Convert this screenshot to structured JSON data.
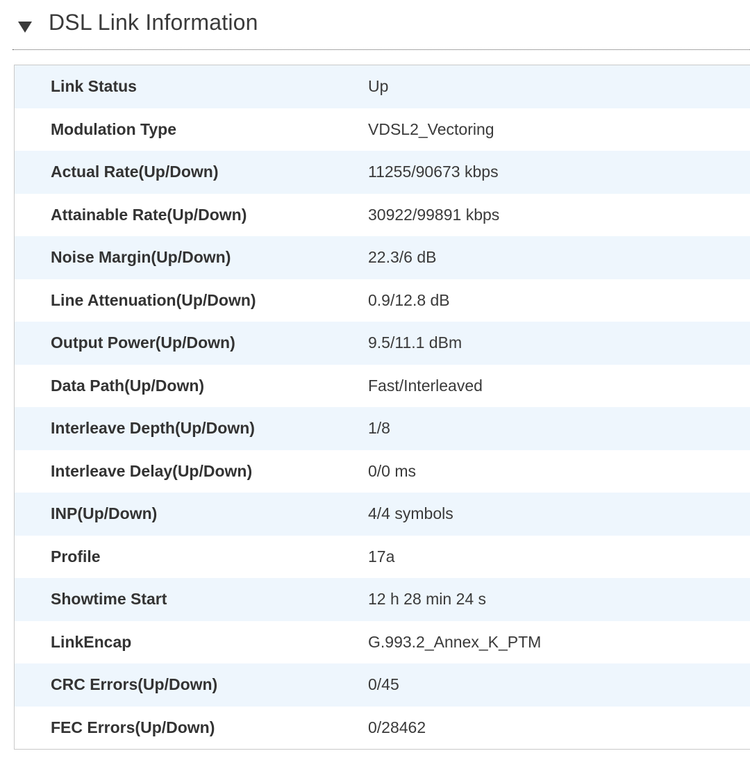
{
  "section": {
    "title": "DSL Link Information"
  },
  "rows": [
    {
      "label": "Link Status",
      "value": "Up"
    },
    {
      "label": "Modulation Type",
      "value": "VDSL2_Vectoring"
    },
    {
      "label": "Actual Rate(Up/Down)",
      "value": "11255/90673 kbps"
    },
    {
      "label": "Attainable Rate(Up/Down)",
      "value": "30922/99891 kbps"
    },
    {
      "label": "Noise Margin(Up/Down)",
      "value": "22.3/6 dB"
    },
    {
      "label": "Line Attenuation(Up/Down)",
      "value": "0.9/12.8 dB"
    },
    {
      "label": "Output Power(Up/Down)",
      "value": "9.5/11.1 dBm"
    },
    {
      "label": "Data Path(Up/Down)",
      "value": "Fast/Interleaved"
    },
    {
      "label": "Interleave Depth(Up/Down)",
      "value": "1/8"
    },
    {
      "label": "Interleave Delay(Up/Down)",
      "value": "0/0 ms"
    },
    {
      "label": "INP(Up/Down)",
      "value": "4/4 symbols"
    },
    {
      "label": "Profile",
      "value": "17a"
    },
    {
      "label": "Showtime Start",
      "value": "12 h 28 min 24 s"
    },
    {
      "label": "LinkEncap",
      "value": "G.993.2_Annex_K_PTM"
    },
    {
      "label": "CRC Errors(Up/Down)",
      "value": "0/45"
    },
    {
      "label": "FEC Errors(Up/Down)",
      "value": "0/28462"
    }
  ]
}
